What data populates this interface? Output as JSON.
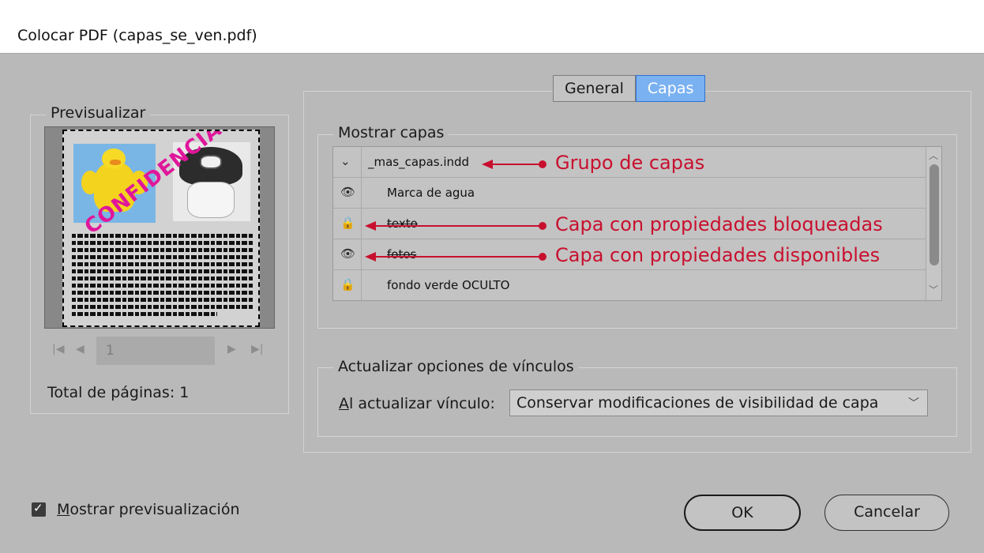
{
  "window": {
    "title": "Colocar PDF (capas_se_ven.pdf)"
  },
  "preview": {
    "group_label": "Previsualizar",
    "watermark_text": "CONFIDENCIAL",
    "page_field_value": "1",
    "total_pages_label": "Total de páginas: 1",
    "pager_icons": [
      "first-page-icon",
      "previous-page-icon",
      "next-page-icon",
      "last-page-icon"
    ]
  },
  "tabs": [
    {
      "label": "General",
      "active": false
    },
    {
      "label": "Capas",
      "active": true
    }
  ],
  "layers": {
    "group_label": "Mostrar capas",
    "rows": [
      {
        "icon": "chevron-down-icon",
        "glyph": "⌄",
        "name": "_mas_capas.indd",
        "indent": false,
        "strike": false
      },
      {
        "icon": "eye-icon",
        "glyph": "👁",
        "name": "Marca de agua",
        "indent": true,
        "strike": false
      },
      {
        "icon": "lock-icon",
        "glyph": "🔒",
        "name": "texto",
        "indent": true,
        "strike": true
      },
      {
        "icon": "eye-icon",
        "glyph": "👁",
        "name": "fotos",
        "indent": true,
        "strike": true
      },
      {
        "icon": "lock-icon",
        "glyph": "🔒",
        "name": "fondo verde OCULTO",
        "indent": true,
        "strike": false
      }
    ]
  },
  "annotations": [
    "Grupo de capas",
    "Capa con propiedades bloqueadas",
    "Capa con propiedades disponibles"
  ],
  "links": {
    "group_label": "Actualizar opciones de vínculos",
    "on_update_label_prefix": "A",
    "on_update_label_rest": "l actualizar vínculo:",
    "on_update_value": "Conservar modificaciones de visibilidad de capa"
  },
  "footer": {
    "show_preview_checked": true,
    "show_preview_label_prefix": "M",
    "show_preview_label_rest": "ostrar previsualización",
    "ok_label": "OK",
    "cancel_label": "Cancelar"
  },
  "colors": {
    "background": "#b9b9b9",
    "accent_tab": "#7ab1f1",
    "annotation_red": "#c8102e",
    "watermark_magenta": "#e0169b"
  }
}
